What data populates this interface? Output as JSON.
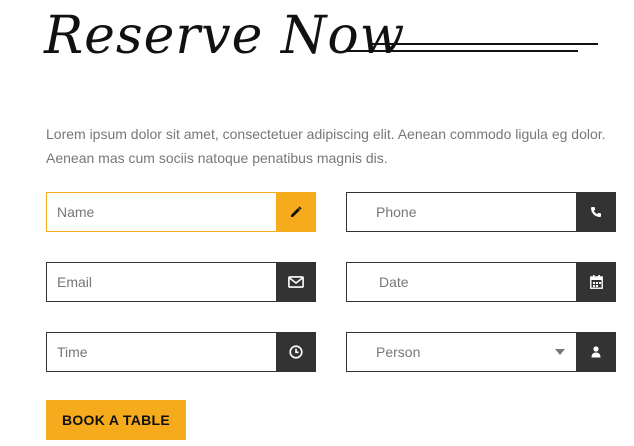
{
  "header": {
    "title": "Reserve Now"
  },
  "intro": {
    "line1": "Lorem ipsum dolor sit amet, consectetuer adipiscing elit. Aenean commodo ligula eg dolor.",
    "line2": "Aenean mas cum sociis natoque penatibus magnis dis."
  },
  "form": {
    "name_placeholder": "Name",
    "phone_placeholder": "Phone",
    "email_placeholder": "Email",
    "date_placeholder": "Date",
    "time_placeholder": "Time",
    "person_selected": "Person",
    "submit_label": "BOOK A TABLE"
  },
  "icons": {
    "name": "pencil-icon",
    "phone": "phone-icon",
    "email": "envelope-icon",
    "date": "calendar-icon",
    "time": "clock-icon",
    "person": "user-icon"
  },
  "colors": {
    "accent": "#f5ab1b",
    "dark": "#333333",
    "text": "#777777"
  }
}
